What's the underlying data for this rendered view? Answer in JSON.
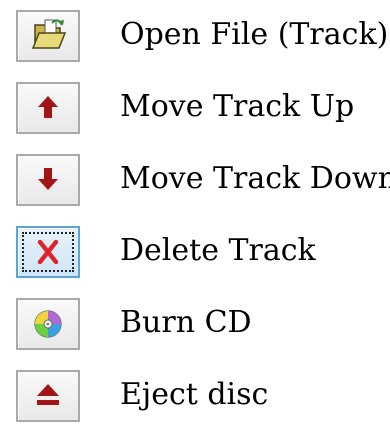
{
  "toolbar": {
    "items": [
      {
        "label": "Open File (Track)",
        "icon": "open-folder-icon"
      },
      {
        "label": "Move Track Up",
        "icon": "arrow-up-icon"
      },
      {
        "label": "Move Track Down",
        "icon": "arrow-down-icon"
      },
      {
        "label": "Delete Track",
        "icon": "delete-x-icon",
        "focused": true
      },
      {
        "label": "Burn CD",
        "icon": "cd-disc-icon"
      },
      {
        "label": "Eject disc",
        "icon": "eject-icon"
      }
    ]
  },
  "colors": {
    "arrow": "#a31515",
    "delete": "#e0242b",
    "focus_border": "#5da4d6"
  }
}
